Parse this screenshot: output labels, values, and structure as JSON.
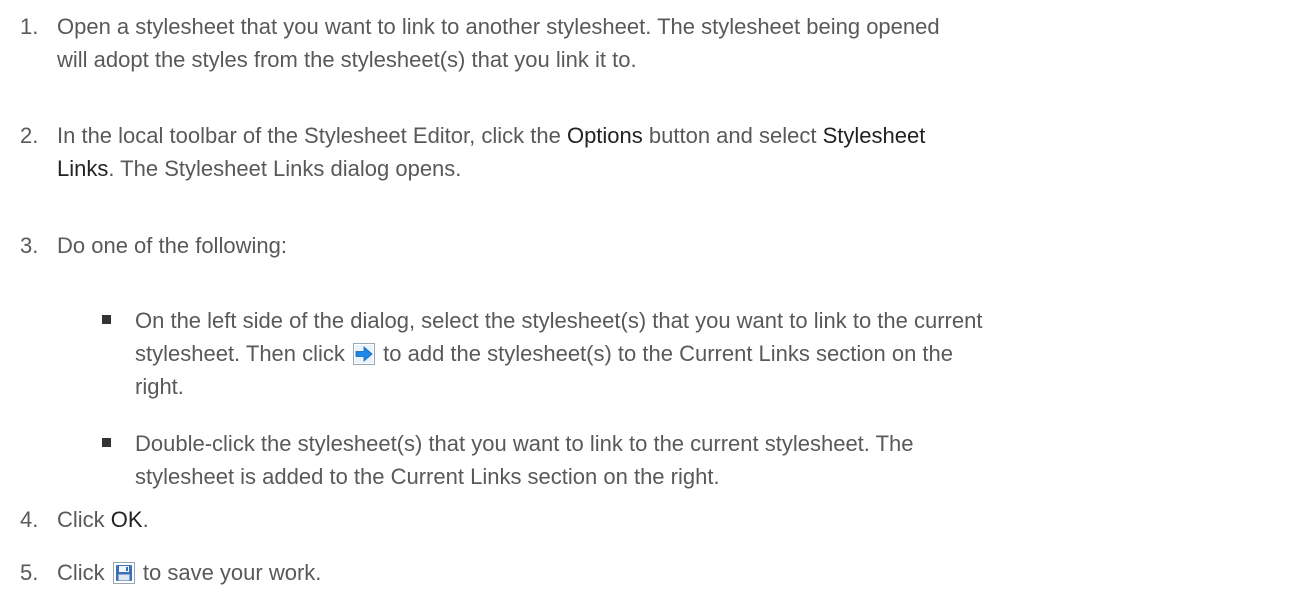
{
  "steps": [
    {
      "num": "1.",
      "line1": "Open a stylesheet that you want to link to another stylesheet. The stylesheet being opened",
      "line2": "will adopt the styles from the stylesheet(s) that you link it to."
    },
    {
      "num": "2.",
      "pre": "In the local toolbar of the Stylesheet Editor, click the ",
      "options": "Options",
      "mid": " button and select ",
      "stylesheet": "Stylesheet",
      "links": "Links",
      "post": ". The Stylesheet Links dialog opens."
    },
    {
      "num": "3.",
      "text": "Do one of the following:"
    },
    {
      "num": "4.",
      "pre": "Click ",
      "ok": "OK",
      "post": "."
    },
    {
      "num": "5.",
      "pre": "Click ",
      "post": " to save your work."
    }
  ],
  "bullets": [
    {
      "line1": "On the left side of the dialog, select the stylesheet(s) that you want to link to the current",
      "line2_pre": "stylesheet. Then click ",
      "line2_post": " to add the stylesheet(s) to the Current Links section on the",
      "line3": "right."
    },
    {
      "line1": "Double-click the stylesheet(s) that you want to link to the current stylesheet. The",
      "line2": "stylesheet is added to the Current Links section on the right."
    }
  ],
  "icons": {
    "add_link": "arrow-right-icon",
    "save": "save-icon"
  },
  "colors": {
    "text": "#595959",
    "emphasis": "#222222",
    "arrow_icon": "#1e88e5",
    "save_icon": "#3b6fb6"
  }
}
